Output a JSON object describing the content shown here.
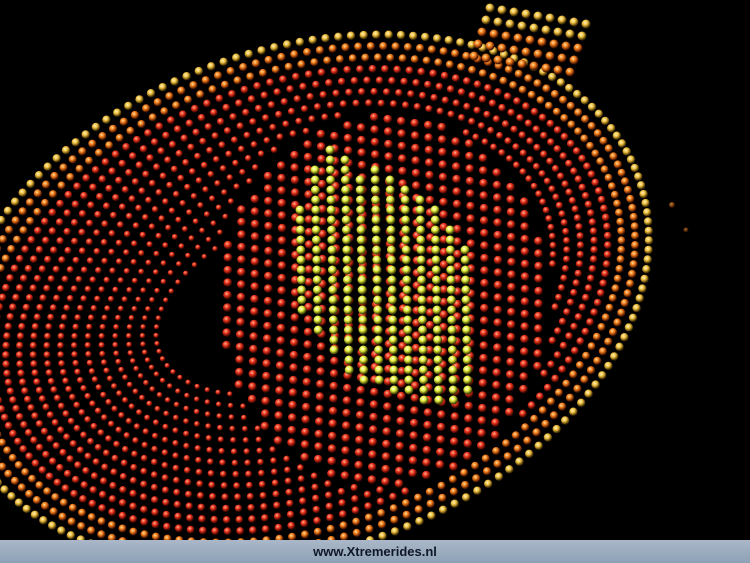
{
  "photo": {
    "subject": "night illuminated amusement-ride sign made of light bulbs",
    "colors": {
      "background": "#000000",
      "outer_bulbs": "#f2c24a",
      "red_bulbs": "#e0301a",
      "crown_bulbs": "#e8f040"
    }
  },
  "footer": {
    "text": "www.Xtremerides.nl"
  }
}
